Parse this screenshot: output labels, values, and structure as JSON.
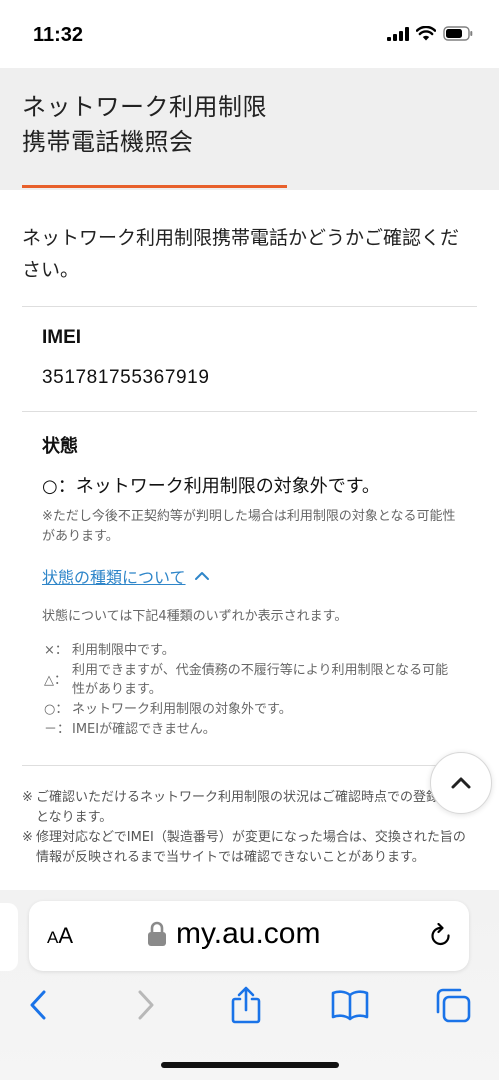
{
  "status_bar": {
    "time": "11:32"
  },
  "header": {
    "title": "ネットワーク利用制限\n携帯電話機照会"
  },
  "intro_text": "ネットワーク利用制限携帯電話かどうかご確認ください。",
  "imei": {
    "label": "IMEI",
    "value": "351781755367919"
  },
  "status": {
    "label": "状態",
    "result": "○：ネットワーク利用制限の対象外です。",
    "note": "※ただし今後不正契約等が判明した場合は利用制限の対象となる可能性があります。"
  },
  "status_types": {
    "link_text": "状態の種類について",
    "description": "状態については下記4種類のいずれか表示されます。",
    "items": [
      {
        "symbol": "×：",
        "text": "利用制限中です。"
      },
      {
        "symbol": "△：",
        "text": "利用できますが、代金債務の不履行等により利用制限となる可能性があります。"
      },
      {
        "symbol": "○：",
        "text": "ネットワーク利用制限の対象外です。"
      },
      {
        "symbol": "－：",
        "text": "IMEIが確認できません。"
      }
    ]
  },
  "footnotes": [
    {
      "mark": "※",
      "text": "ご確認いただけるネットワーク利用制限の状況はご確認時点での登録状況となります。"
    },
    {
      "mark": "※",
      "text": "修理対応などでIMEI（製造番号）が変更になった場合は、交換された旨の情報が反映されるまで当サイトでは確認できないことがあります。"
    }
  ],
  "browser": {
    "aa_label_small": "A",
    "aa_label_large": "A",
    "url": "my.au.com"
  },
  "colors": {
    "accent": "#e8602b",
    "link": "#2f86c9",
    "header_bg": "#efefef",
    "ios_blue": "#1a73e8"
  },
  "icons": [
    "cellular-signal-icon",
    "wifi-icon",
    "battery-icon",
    "chevron-up-icon",
    "lock-icon",
    "reload-icon",
    "back-icon",
    "forward-icon",
    "share-icon",
    "bookmarks-icon",
    "tabs-icon"
  ]
}
